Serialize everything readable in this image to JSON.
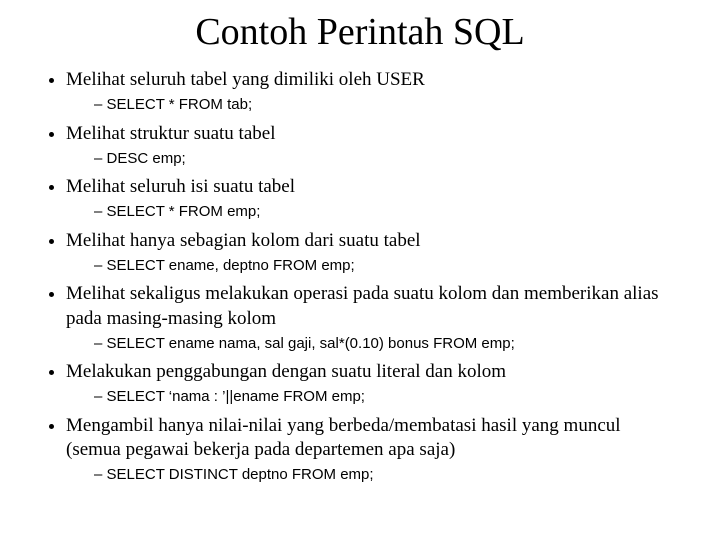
{
  "title": "Contoh Perintah SQL",
  "items": [
    {
      "text": "Melihat seluruh tabel yang dimiliki oleh USER",
      "code": "SELECT * FROM tab;"
    },
    {
      "text": "Melihat struktur suatu tabel",
      "code": "DESC emp;"
    },
    {
      "text": "Melihat seluruh isi suatu tabel",
      "code": "SELECT * FROM emp;"
    },
    {
      "text": "Melihat hanya sebagian kolom dari suatu tabel",
      "code": "SELECT ename, deptno FROM emp;"
    },
    {
      "text": "Melihat sekaligus melakukan operasi pada suatu kolom dan memberikan alias pada masing-masing kolom",
      "code": "SELECT ename nama, sal gaji, sal*(0.10) bonus FROM emp;"
    },
    {
      "text": "Melakukan penggabungan dengan suatu literal dan kolom",
      "code": "SELECT ‘nama : ’||ename FROM emp;"
    },
    {
      "text": "Mengambil hanya nilai-nilai yang berbeda/membatasi hasil yang muncul (semua pegawai bekerja pada departemen apa saja)",
      "code": "SELECT DISTINCT deptno FROM emp;"
    }
  ]
}
